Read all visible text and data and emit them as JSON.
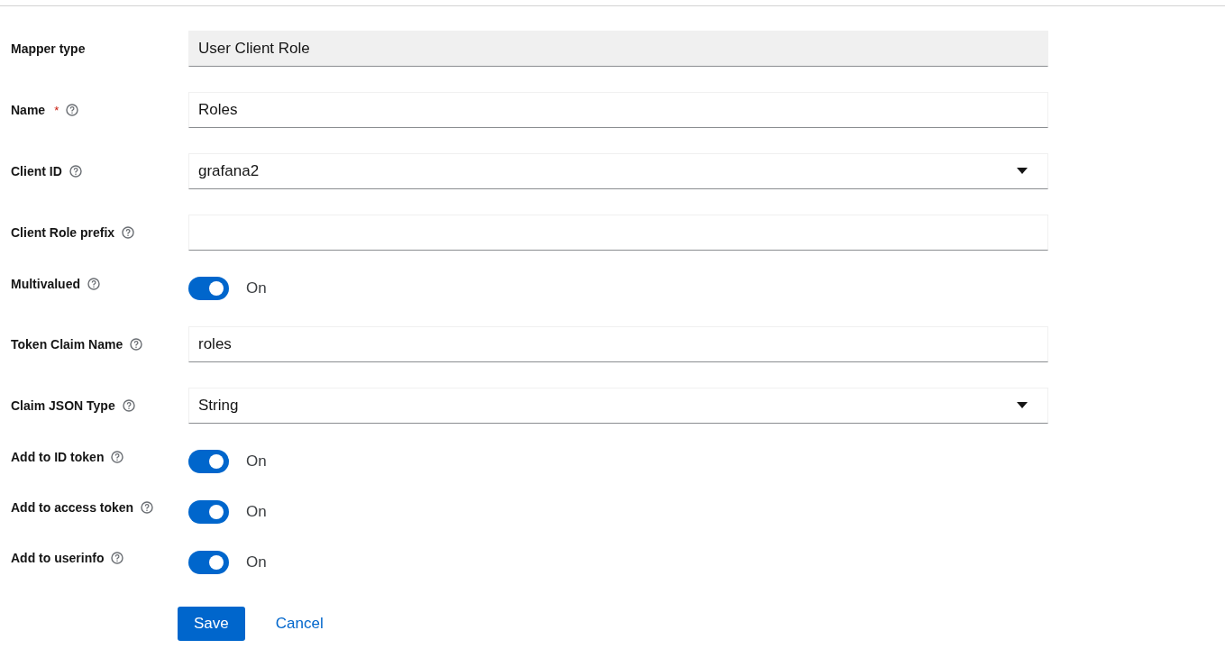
{
  "fields": [
    {
      "kind": "readonly",
      "label": "Mapper type",
      "help": false,
      "value": "User Client Role"
    },
    {
      "kind": "text",
      "label": "Name",
      "required_mark": "*",
      "help": true,
      "value": "Roles"
    },
    {
      "kind": "select",
      "label": "Client ID",
      "help": true,
      "value": "grafana2"
    },
    {
      "kind": "text",
      "label": "Client Role prefix",
      "help": true
    },
    {
      "kind": "switch",
      "label": "Multivalued",
      "help": true,
      "on": true,
      "state_text": "On"
    },
    {
      "kind": "text",
      "label": "Token Claim Name",
      "help": true,
      "value": "roles"
    },
    {
      "kind": "select",
      "label": "Claim JSON Type",
      "help": true,
      "value": "String"
    },
    {
      "kind": "switch",
      "label": "Add to ID token",
      "help": true,
      "on": true,
      "state_text": "On"
    },
    {
      "kind": "switch",
      "label": "Add to access token",
      "help": true,
      "on": true,
      "state_text": "On"
    },
    {
      "kind": "switch",
      "label": "Add to userinfo",
      "help": true,
      "on": true,
      "state_text": "On"
    }
  ],
  "actions": {
    "save": "Save",
    "cancel": "Cancel"
  }
}
